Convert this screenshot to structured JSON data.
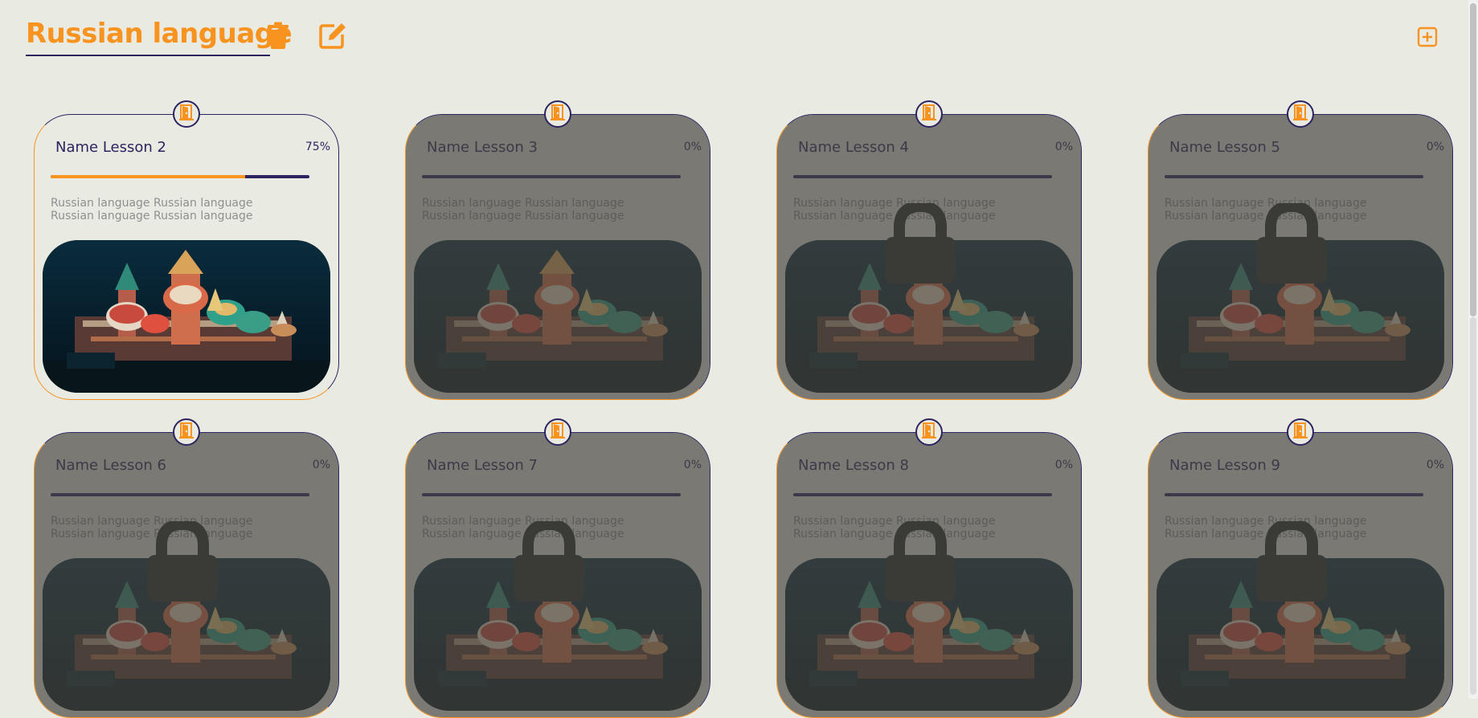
{
  "course": {
    "title": "Russian language"
  },
  "icons": {
    "delete": "trash-icon",
    "edit": "edit-icon",
    "add": "plus-square-icon",
    "lesson_node": "door-open-icon",
    "locked": "lock-icon"
  },
  "colors": {
    "accent": "#f7931e",
    "primary": "#2b2460",
    "background": "#e9eae2"
  },
  "lessons": [
    {
      "name": "Name Lesson 2",
      "progress_label": "75%",
      "progress": 0.75,
      "description": "Russian language Russian language Russian language Russian language",
      "locked": false,
      "dimmed": false
    },
    {
      "name": "Name Lesson 3",
      "progress_label": "0%",
      "progress": 0,
      "description": "Russian language Russian language Russian language Russian language",
      "locked": false,
      "dimmed": true
    },
    {
      "name": "Name Lesson 4",
      "progress_label": "0%",
      "progress": 0,
      "description": "Russian language Russian language Russian language Russian language",
      "locked": true,
      "dimmed": true
    },
    {
      "name": "Name Lesson 5",
      "progress_label": "0%",
      "progress": 0,
      "description": "Russian language Russian language Russian language Russian language",
      "locked": true,
      "dimmed": true
    },
    {
      "name": "Name Lesson 6",
      "progress_label": "0%",
      "progress": 0,
      "description": "Russian language Russian language Russian language Russian language",
      "locked": true,
      "dimmed": true
    },
    {
      "name": "Name Lesson 7",
      "progress_label": "0%",
      "progress": 0,
      "description": "Russian language Russian language Russian language Russian language",
      "locked": true,
      "dimmed": true
    },
    {
      "name": "Name Lesson 8",
      "progress_label": "0%",
      "progress": 0,
      "description": "Russian language Russian language Russian language Russian language",
      "locked": true,
      "dimmed": true
    },
    {
      "name": "Name Lesson 9",
      "progress_label": "0%",
      "progress": 0,
      "description": "Russian language Russian language Russian language Russian language",
      "locked": true,
      "dimmed": true
    }
  ]
}
